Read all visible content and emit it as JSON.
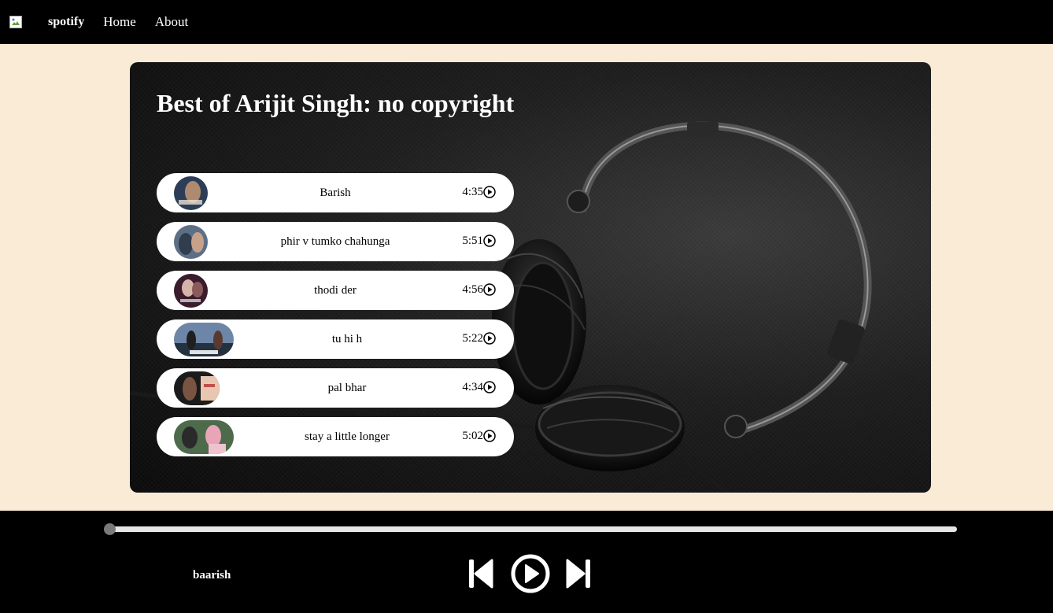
{
  "nav": {
    "logo_icon": "broken-image-icon",
    "brand": "spotify",
    "links": [
      "Home",
      "About"
    ]
  },
  "playlist": {
    "title": "Best of Arijit Singh: no copyright",
    "songs": [
      {
        "name": "Barish",
        "duration": "4:35",
        "thumb_colors": [
          "#2c3e57",
          "#b08a6e"
        ]
      },
      {
        "name": "phir v tumko chahunga",
        "duration": "5:51",
        "thumb_colors": [
          "#5c6f86",
          "#c7a28a"
        ]
      },
      {
        "name": "thodi der",
        "duration": "4:56",
        "thumb_colors": [
          "#3a1c2c",
          "#d7b4a8"
        ]
      },
      {
        "name": "tu hi h",
        "duration": "5:22",
        "thumb_colors": [
          "#6d86a8",
          "#24313f"
        ]
      },
      {
        "name": "pal bhar",
        "duration": "4:34",
        "thumb_colors": [
          "#1b1b1b",
          "#e9c6b2"
        ]
      },
      {
        "name": "stay a little longer",
        "duration": "5:02",
        "thumb_colors": [
          "#4d6a4a",
          "#e9a5b8"
        ]
      }
    ]
  },
  "player": {
    "now_playing": "baarish",
    "progress": 0.0,
    "icons": [
      "previous-icon",
      "play-icon",
      "next-icon"
    ]
  },
  "colors": {
    "page_bg": "#faebd7",
    "bar_bg": "#000000",
    "pill_bg": "#ffffff"
  }
}
